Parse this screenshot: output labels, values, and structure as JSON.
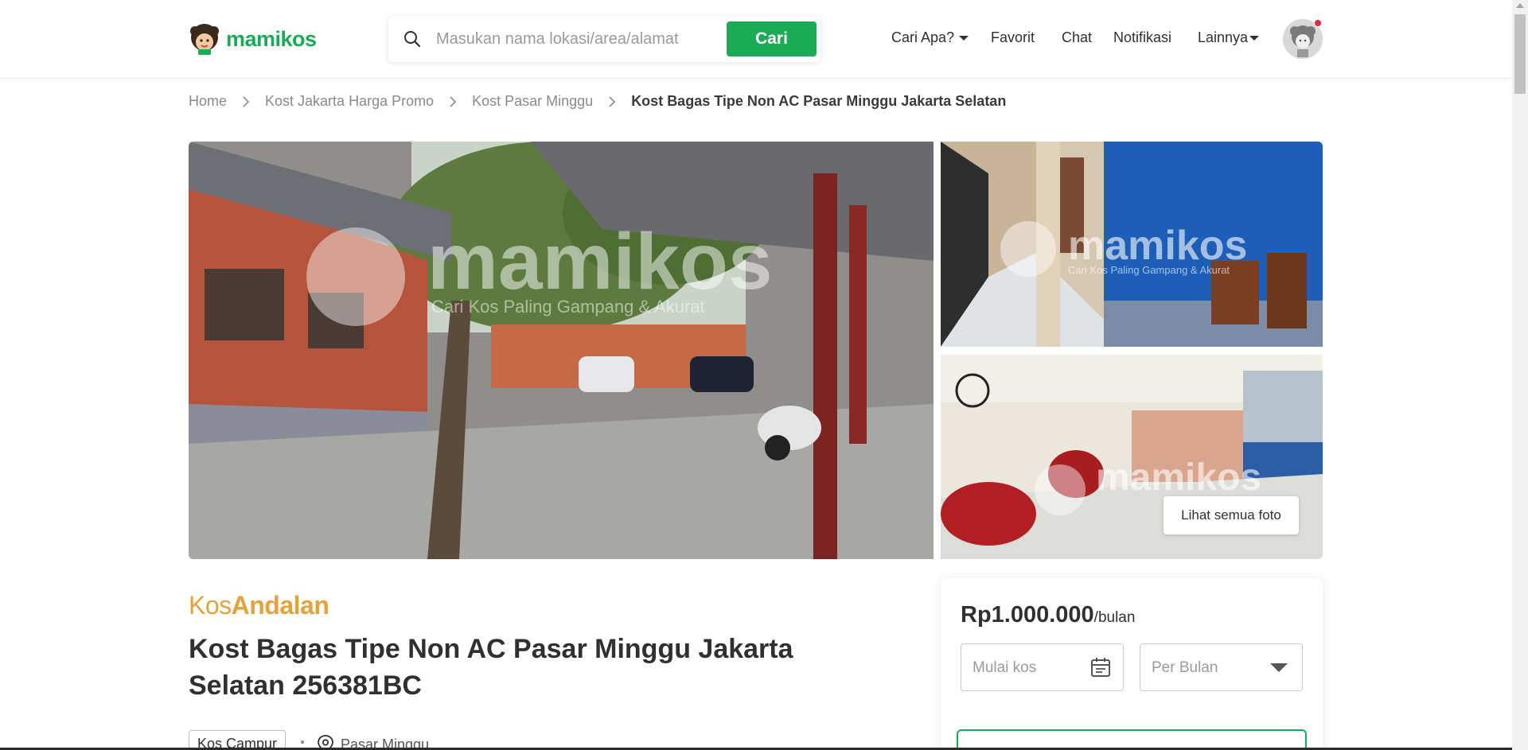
{
  "header": {
    "logo_text": "mamikos",
    "search": {
      "placeholder": "Masukan nama lokasi/area/alamat",
      "button_label": "Cari"
    },
    "nav": [
      {
        "label": "Cari Apa?",
        "dropdown": true
      },
      {
        "label": "Favorit",
        "dropdown": false
      },
      {
        "label": "Chat",
        "dropdown": false
      },
      {
        "label": "Notifikasi",
        "dropdown": false
      },
      {
        "label": "Lainnya",
        "dropdown": true
      }
    ],
    "has_notification_dot": true
  },
  "breadcrumb": [
    "Home",
    "Kost Jakarta Harga Promo",
    "Kost Pasar Minggu",
    "Kost Bagas Tipe Non AC Pasar Minggu Jakarta Selatan"
  ],
  "gallery": {
    "watermark_text": "mamikos",
    "watermark_tagline": "Cari Kos Paling Gampang & Akurat",
    "see_all_label": "Lihat semua foto"
  },
  "listing": {
    "brand_light": "Kos",
    "brand_bold": "Andalan",
    "title": "Kost Bagas Tipe Non AC Pasar Minggu Jakarta Selatan 256381BC",
    "gender_tag": "Kos Campur",
    "location": "Pasar Minggu"
  },
  "price_card": {
    "price": "Rp1.000.000",
    "unit": "/bulan",
    "start_placeholder": "Mulai kos",
    "period_value": "Per Bulan"
  },
  "colors": {
    "brand_green": "#1baa56",
    "brand_gold": "#e4a23c",
    "notification_red": "#e8263d"
  }
}
